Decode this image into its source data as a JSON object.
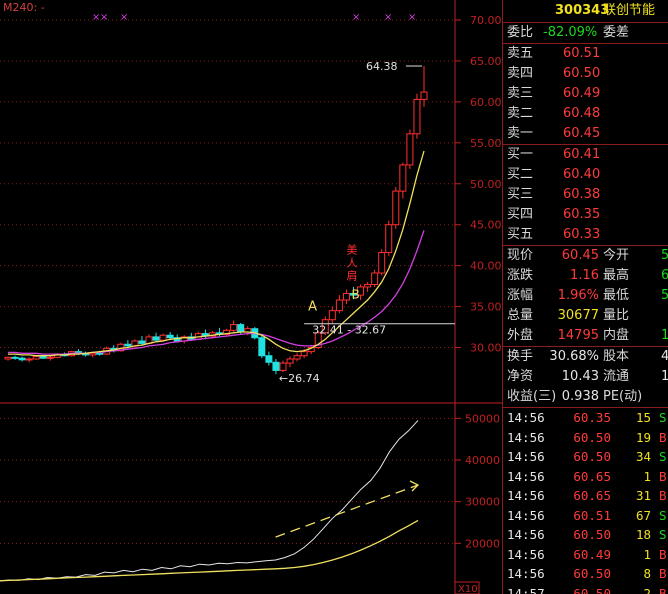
{
  "indicator_label": "M240: -",
  "upper_chart": {
    "y_axis": [
      "70.00",
      "65.00",
      "60.00",
      "55.00",
      "50.00",
      "45.00",
      "40.00",
      "35.00",
      "30.00"
    ],
    "annotations": {
      "high": "64.38",
      "low": "←26.74",
      "range": "32.41 - 32.67",
      "mark_a": "A",
      "mark_b": "B",
      "vertical": [
        "美",
        "人",
        "肩"
      ]
    },
    "candles": [
      [
        28.6,
        28.9,
        28.4,
        28.8
      ],
      [
        28.8,
        29.0,
        28.5,
        28.7
      ],
      [
        28.7,
        28.9,
        28.3,
        28.5
      ],
      [
        28.5,
        28.8,
        28.2,
        28.6
      ],
      [
        28.6,
        29.0,
        28.5,
        28.9
      ],
      [
        28.9,
        29.1,
        28.6,
        28.7
      ],
      [
        28.7,
        29.0,
        28.4,
        28.8
      ],
      [
        28.8,
        29.3,
        28.7,
        29.2
      ],
      [
        29.2,
        29.4,
        28.9,
        29.0
      ],
      [
        29.0,
        29.6,
        28.9,
        29.5
      ],
      [
        29.5,
        29.8,
        29.1,
        29.3
      ],
      [
        29.3,
        29.5,
        28.9,
        29.1
      ],
      [
        29.1,
        29.4,
        28.8,
        29.3
      ],
      [
        29.3,
        29.6,
        29.0,
        29.2
      ],
      [
        29.2,
        30.1,
        29.1,
        29.9
      ],
      [
        29.9,
        30.3,
        29.4,
        29.6
      ],
      [
        29.6,
        30.6,
        29.5,
        30.4
      ],
      [
        30.4,
        30.9,
        30.0,
        30.2
      ],
      [
        30.2,
        31.0,
        30.0,
        30.8
      ],
      [
        30.8,
        31.4,
        30.3,
        30.5
      ],
      [
        30.5,
        31.6,
        30.4,
        31.3
      ],
      [
        31.3,
        31.8,
        30.7,
        30.9
      ],
      [
        30.9,
        31.7,
        30.8,
        31.5
      ],
      [
        31.5,
        31.9,
        30.9,
        31.2
      ],
      [
        31.2,
        31.6,
        30.6,
        30.8
      ],
      [
        30.8,
        31.5,
        30.5,
        31.3
      ],
      [
        31.3,
        31.8,
        30.8,
        31.0
      ],
      [
        31.0,
        31.9,
        30.9,
        31.7
      ],
      [
        31.7,
        32.2,
        31.0,
        31.4
      ],
      [
        31.4,
        32.0,
        31.2,
        31.8
      ],
      [
        31.8,
        32.4,
        31.4,
        31.6
      ],
      [
        31.6,
        32.3,
        31.5,
        32.1
      ],
      [
        32.1,
        33.3,
        31.9,
        32.8
      ],
      [
        32.8,
        33.0,
        31.6,
        31.9
      ],
      [
        31.9,
        32.6,
        31.5,
        32.3
      ],
      [
        32.3,
        32.5,
        31.0,
        31.2
      ],
      [
        31.2,
        31.5,
        28.7,
        29.0
      ],
      [
        29.0,
        29.5,
        27.8,
        28.2
      ],
      [
        28.2,
        28.6,
        26.74,
        27.2
      ],
      [
        27.2,
        28.4,
        27.0,
        28.1
      ],
      [
        28.1,
        28.9,
        27.6,
        28.6
      ],
      [
        28.6,
        29.3,
        28.3,
        29.0
      ],
      [
        29.0,
        29.8,
        28.7,
        29.5
      ],
      [
        29.5,
        30.3,
        29.2,
        30.0
      ],
      [
        30.0,
        32.0,
        29.8,
        31.8
      ],
      [
        31.8,
        33.8,
        31.5,
        33.4
      ],
      [
        33.4,
        35.0,
        33.0,
        34.5
      ],
      [
        34.5,
        36.4,
        34.2,
        35.8
      ],
      [
        35.8,
        37.1,
        35.3,
        36.6
      ],
      [
        36.6,
        37.4,
        35.9,
        36.4
      ],
      [
        36.4,
        37.7,
        35.8,
        37.4
      ],
      [
        37.4,
        38.0,
        36.8,
        37.7
      ],
      [
        37.7,
        39.5,
        37.4,
        39.1
      ],
      [
        39.1,
        42.0,
        38.8,
        41.6
      ],
      [
        41.6,
        45.5,
        41.2,
        45.0
      ],
      [
        45.0,
        49.6,
        44.5,
        49.1
      ],
      [
        49.1,
        52.6,
        48.2,
        52.3
      ],
      [
        52.3,
        56.6,
        51.8,
        56.1
      ],
      [
        56.1,
        61.0,
        55.5,
        60.3
      ],
      [
        60.3,
        64.38,
        59.4,
        61.2
      ]
    ],
    "ma_yellow": [
      29.2,
      29.2,
      29.1,
      29.1,
      29.0,
      29.0,
      29.0,
      29.1,
      29.1,
      29.2,
      29.2,
      29.3,
      29.4,
      29.5,
      29.6,
      29.7,
      29.9,
      30.0,
      30.2,
      30.3,
      30.5,
      30.7,
      30.8,
      31.0,
      31.1,
      31.2,
      31.2,
      31.3,
      31.4,
      31.5,
      31.6,
      31.7,
      31.8,
      31.9,
      31.9,
      31.8,
      31.5,
      31.0,
      30.4,
      29.9,
      29.6,
      29.5,
      29.6,
      29.9,
      30.4,
      31.0,
      31.8,
      32.6,
      33.4,
      34.2,
      35.0,
      35.8,
      36.8,
      38.0,
      39.6,
      41.8,
      44.4,
      47.6,
      51.0,
      54.0
    ],
    "ma_purple": [
      29.4,
      29.4,
      29.3,
      29.3,
      29.3,
      29.2,
      29.2,
      29.2,
      29.2,
      29.3,
      29.3,
      29.3,
      29.4,
      29.4,
      29.5,
      29.6,
      29.7,
      29.8,
      29.9,
      30.0,
      30.2,
      30.3,
      30.4,
      30.6,
      30.7,
      30.8,
      30.9,
      31.0,
      31.1,
      31.2,
      31.3,
      31.4,
      31.5,
      31.6,
      31.7,
      31.7,
      31.6,
      31.4,
      31.1,
      30.8,
      30.5,
      30.3,
      30.2,
      30.2,
      30.3,
      30.5,
      30.8,
      31.2,
      31.6,
      32.1,
      32.6,
      33.1,
      33.7,
      34.4,
      35.3,
      36.4,
      37.8,
      39.6,
      41.8,
      44.3
    ]
  },
  "lower_chart": {
    "y_axis": [
      "50000",
      "40000",
      "30000",
      "20000"
    ],
    "multiplier": "X10",
    "line_white": [
      11000,
      11200,
      11100,
      11500,
      11300,
      11800,
      11600,
      12000,
      11900,
      12500,
      12300,
      13100,
      12900,
      13500,
      13200,
      13800,
      13500,
      14200,
      13900,
      14600,
      14400,
      15000,
      14800,
      15200,
      15100,
      15400,
      15300,
      15600,
      15800,
      16000,
      16600,
      17500,
      19000,
      21000,
      23500,
      26000,
      28000,
      30500,
      33000,
      35000,
      38000,
      42000,
      45000,
      47000,
      49500
    ],
    "line_yellow": [
      11000,
      11100,
      11200,
      11300,
      11400,
      11500,
      11600,
      11700,
      11800,
      11900,
      12000,
      12100,
      12200,
      12300,
      12400,
      12500,
      12600,
      12700,
      12800,
      12900,
      13000,
      13100,
      13200,
      13300,
      13400,
      13500,
      13600,
      13700,
      13800,
      13900,
      14000,
      14200,
      14500,
      14900,
      15400,
      16000,
      16700,
      17500,
      18400,
      19400,
      20500,
      21700,
      23000,
      24200,
      25500
    ],
    "line_dashed": [
      [
        29,
        21500
      ],
      [
        44,
        34000
      ]
    ]
  },
  "panel": {
    "code": "300343",
    "name": "联创节能",
    "wei_bi_label": "委比",
    "wei_bi_value": "-82.09%",
    "wei_cha_label": "委差",
    "sell": [
      {
        "label": "卖五",
        "price": "60.51"
      },
      {
        "label": "卖四",
        "price": "60.50"
      },
      {
        "label": "卖三",
        "price": "60.49"
      },
      {
        "label": "卖二",
        "price": "60.48"
      },
      {
        "label": "卖一",
        "price": "60.45"
      }
    ],
    "buy": [
      {
        "label": "买一",
        "price": "60.41"
      },
      {
        "label": "买二",
        "price": "60.40"
      },
      {
        "label": "买三",
        "price": "60.38"
      },
      {
        "label": "买四",
        "price": "60.35"
      },
      {
        "label": "买五",
        "price": "60.33"
      }
    ],
    "quote": [
      {
        "l1": "现价",
        "v1": "60.45",
        "l2": "今开",
        "v2": "5"
      },
      {
        "l1": "涨跌",
        "v1": "1.16",
        "l2": "最高",
        "v2": "6"
      },
      {
        "l1": "涨幅",
        "v1": "1.96%",
        "l2": "最低",
        "v2": "5"
      },
      {
        "l1": "总量",
        "v1": "30677",
        "l2": "量比",
        "v2": ""
      },
      {
        "l1": "外盘",
        "v1": "14795",
        "l2": "内盘",
        "v2": "1"
      }
    ],
    "stats": [
      {
        "l1": "换手",
        "v1": "30.68%",
        "l2": "股本",
        "v2": "40"
      },
      {
        "l1": "净资",
        "v1": "10.43",
        "l2": "流通",
        "v2": "10"
      },
      {
        "l1": "收益(三)",
        "v1": "0.938",
        "l2": "PE(动)",
        "v2": ""
      }
    ],
    "ticks": [
      {
        "time": "14:56",
        "price": "60.35",
        "vol": "15",
        "side": "S"
      },
      {
        "time": "14:56",
        "price": "60.50",
        "vol": "19",
        "side": "B"
      },
      {
        "time": "14:56",
        "price": "60.50",
        "vol": "34",
        "side": "S"
      },
      {
        "time": "14:56",
        "price": "60.65",
        "vol": "1",
        "side": "B"
      },
      {
        "time": "14:56",
        "price": "60.65",
        "vol": "31",
        "side": "B"
      },
      {
        "time": "14:56",
        "price": "60.51",
        "vol": "67",
        "side": "S"
      },
      {
        "time": "14:56",
        "price": "60.50",
        "vol": "18",
        "side": "S"
      },
      {
        "time": "14:56",
        "price": "60.49",
        "vol": "1",
        "side": "B"
      },
      {
        "time": "14:56",
        "price": "60.50",
        "vol": "8",
        "side": "B"
      },
      {
        "time": "14:57",
        "price": "60.50",
        "vol": "2",
        "side": "B"
      },
      {
        "time": "14:57",
        "price": "60.58",
        "vol": "1",
        "side": "B"
      }
    ]
  },
  "colors": {
    "up": "#ff3030",
    "down": "#20e0e0",
    "ma1": "#f0e060",
    "ma2": "#d040e0",
    "grid": "#8a1c1c",
    "axis": "#c02020"
  }
}
